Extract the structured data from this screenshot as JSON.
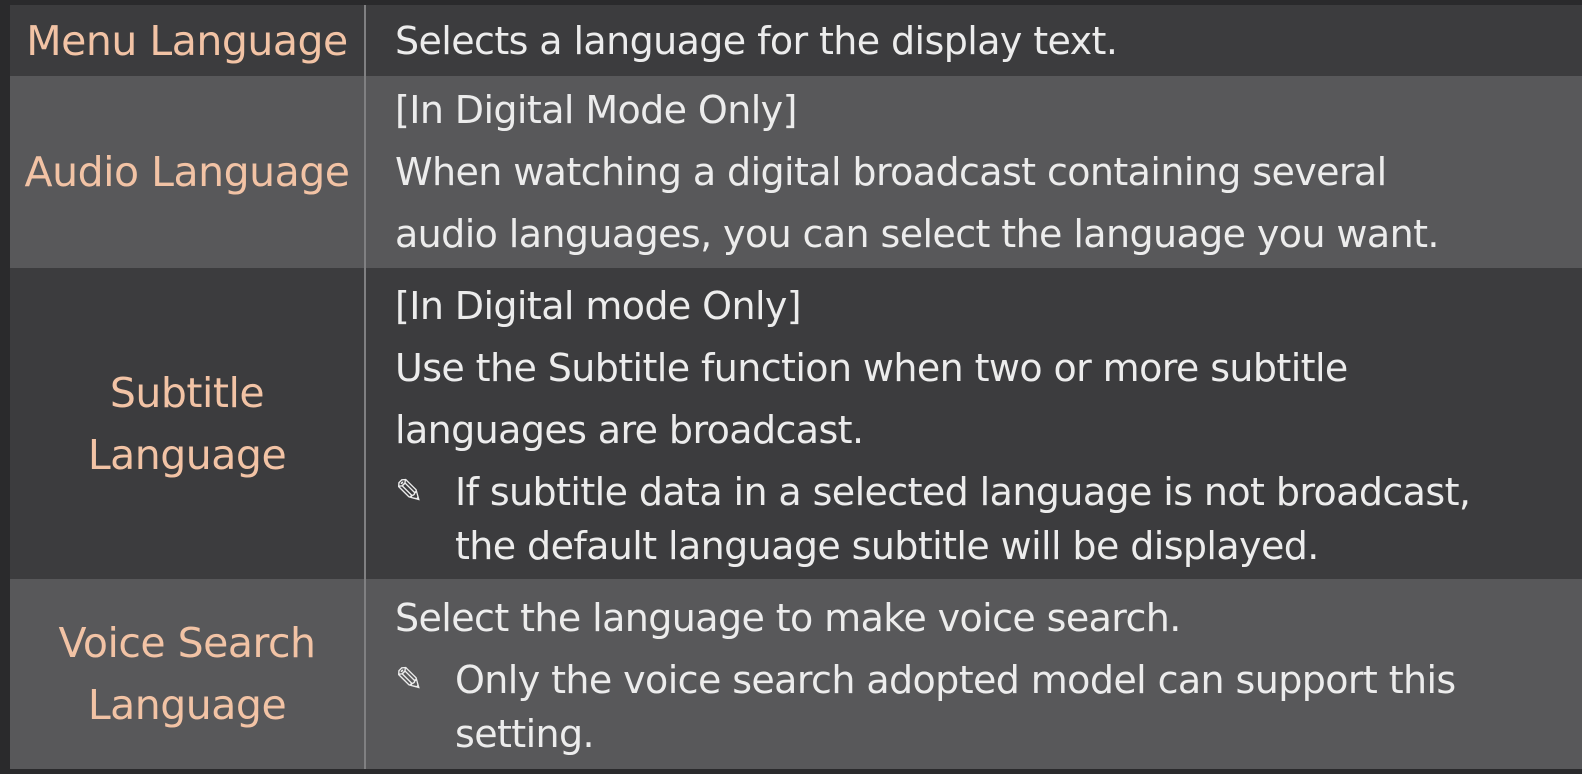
{
  "rows": [
    {
      "label": "Menu Language",
      "lines": [
        "Selects a language for the display text."
      ]
    },
    {
      "label": "Audio Language",
      "lines": [
        "[In Digital Mode Only]",
        "When watching a digital broadcast containing several",
        "audio languages, you can select the language you want."
      ]
    },
    {
      "label_lines": [
        "Subtitle",
        "Language"
      ],
      "lines": [
        "[In Digital mode Only]",
        "Use the Subtitle function when two or more subtitle",
        "languages are broadcast."
      ],
      "note": {
        "icon": "pencil-note-icon",
        "lines": [
          "If subtitle data in a selected language is not broadcast,",
          "the default language subtitle will be displayed."
        ]
      }
    },
    {
      "label_lines": [
        "Voice Search",
        "Language"
      ],
      "lines": [
        "Select the language to make voice search."
      ],
      "note": {
        "icon": "pencil-note-icon",
        "lines": [
          "Only the voice search adopted model can support this",
          "setting."
        ]
      }
    }
  ],
  "colors": {
    "page_background": "#2a2a2c",
    "row_dark": "#3c3c3e",
    "row_light": "#58585a",
    "label_text": "#f2c3a5",
    "body_text": "#ececec",
    "divider": "#808082"
  }
}
